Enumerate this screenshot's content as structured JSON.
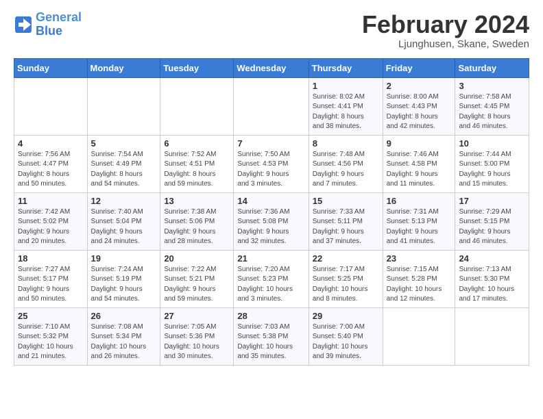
{
  "header": {
    "logo_line1": "General",
    "logo_line2": "Blue",
    "title": "February 2024",
    "location": "Ljunghusen, Skane, Sweden"
  },
  "days_of_week": [
    "Sunday",
    "Monday",
    "Tuesday",
    "Wednesday",
    "Thursday",
    "Friday",
    "Saturday"
  ],
  "weeks": [
    [
      {
        "day": "",
        "info": ""
      },
      {
        "day": "",
        "info": ""
      },
      {
        "day": "",
        "info": ""
      },
      {
        "day": "",
        "info": ""
      },
      {
        "day": "1",
        "info": "Sunrise: 8:02 AM\nSunset: 4:41 PM\nDaylight: 8 hours\nand 38 minutes."
      },
      {
        "day": "2",
        "info": "Sunrise: 8:00 AM\nSunset: 4:43 PM\nDaylight: 8 hours\nand 42 minutes."
      },
      {
        "day": "3",
        "info": "Sunrise: 7:58 AM\nSunset: 4:45 PM\nDaylight: 8 hours\nand 46 minutes."
      }
    ],
    [
      {
        "day": "4",
        "info": "Sunrise: 7:56 AM\nSunset: 4:47 PM\nDaylight: 8 hours\nand 50 minutes."
      },
      {
        "day": "5",
        "info": "Sunrise: 7:54 AM\nSunset: 4:49 PM\nDaylight: 8 hours\nand 54 minutes."
      },
      {
        "day": "6",
        "info": "Sunrise: 7:52 AM\nSunset: 4:51 PM\nDaylight: 8 hours\nand 59 minutes."
      },
      {
        "day": "7",
        "info": "Sunrise: 7:50 AM\nSunset: 4:53 PM\nDaylight: 9 hours\nand 3 minutes."
      },
      {
        "day": "8",
        "info": "Sunrise: 7:48 AM\nSunset: 4:56 PM\nDaylight: 9 hours\nand 7 minutes."
      },
      {
        "day": "9",
        "info": "Sunrise: 7:46 AM\nSunset: 4:58 PM\nDaylight: 9 hours\nand 11 minutes."
      },
      {
        "day": "10",
        "info": "Sunrise: 7:44 AM\nSunset: 5:00 PM\nDaylight: 9 hours\nand 15 minutes."
      }
    ],
    [
      {
        "day": "11",
        "info": "Sunrise: 7:42 AM\nSunset: 5:02 PM\nDaylight: 9 hours\nand 20 minutes."
      },
      {
        "day": "12",
        "info": "Sunrise: 7:40 AM\nSunset: 5:04 PM\nDaylight: 9 hours\nand 24 minutes."
      },
      {
        "day": "13",
        "info": "Sunrise: 7:38 AM\nSunset: 5:06 PM\nDaylight: 9 hours\nand 28 minutes."
      },
      {
        "day": "14",
        "info": "Sunrise: 7:36 AM\nSunset: 5:08 PM\nDaylight: 9 hours\nand 32 minutes."
      },
      {
        "day": "15",
        "info": "Sunrise: 7:33 AM\nSunset: 5:11 PM\nDaylight: 9 hours\nand 37 minutes."
      },
      {
        "day": "16",
        "info": "Sunrise: 7:31 AM\nSunset: 5:13 PM\nDaylight: 9 hours\nand 41 minutes."
      },
      {
        "day": "17",
        "info": "Sunrise: 7:29 AM\nSunset: 5:15 PM\nDaylight: 9 hours\nand 46 minutes."
      }
    ],
    [
      {
        "day": "18",
        "info": "Sunrise: 7:27 AM\nSunset: 5:17 PM\nDaylight: 9 hours\nand 50 minutes."
      },
      {
        "day": "19",
        "info": "Sunrise: 7:24 AM\nSunset: 5:19 PM\nDaylight: 9 hours\nand 54 minutes."
      },
      {
        "day": "20",
        "info": "Sunrise: 7:22 AM\nSunset: 5:21 PM\nDaylight: 9 hours\nand 59 minutes."
      },
      {
        "day": "21",
        "info": "Sunrise: 7:20 AM\nSunset: 5:23 PM\nDaylight: 10 hours\nand 3 minutes."
      },
      {
        "day": "22",
        "info": "Sunrise: 7:17 AM\nSunset: 5:25 PM\nDaylight: 10 hours\nand 8 minutes."
      },
      {
        "day": "23",
        "info": "Sunrise: 7:15 AM\nSunset: 5:28 PM\nDaylight: 10 hours\nand 12 minutes."
      },
      {
        "day": "24",
        "info": "Sunrise: 7:13 AM\nSunset: 5:30 PM\nDaylight: 10 hours\nand 17 minutes."
      }
    ],
    [
      {
        "day": "25",
        "info": "Sunrise: 7:10 AM\nSunset: 5:32 PM\nDaylight: 10 hours\nand 21 minutes."
      },
      {
        "day": "26",
        "info": "Sunrise: 7:08 AM\nSunset: 5:34 PM\nDaylight: 10 hours\nand 26 minutes."
      },
      {
        "day": "27",
        "info": "Sunrise: 7:05 AM\nSunset: 5:36 PM\nDaylight: 10 hours\nand 30 minutes."
      },
      {
        "day": "28",
        "info": "Sunrise: 7:03 AM\nSunset: 5:38 PM\nDaylight: 10 hours\nand 35 minutes."
      },
      {
        "day": "29",
        "info": "Sunrise: 7:00 AM\nSunset: 5:40 PM\nDaylight: 10 hours\nand 39 minutes."
      },
      {
        "day": "",
        "info": ""
      },
      {
        "day": "",
        "info": ""
      }
    ]
  ]
}
